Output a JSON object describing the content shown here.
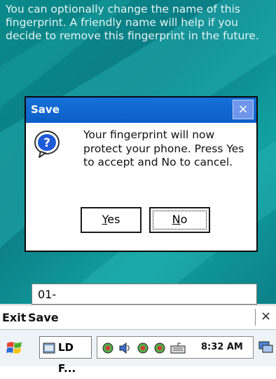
{
  "instructions": "You can optionally change the name of this fingerprint. A friendly name will help if you decide to remove this fingerprint in the future.",
  "dialog": {
    "title": "Save",
    "message": "Your fingerprint will now protect your phone. Press Yes to accept and No to cancel.",
    "yes_mnemonic": "Y",
    "yes_rest": "es",
    "no_mnemonic": "N",
    "no_rest": "o",
    "close_glyph": "×",
    "icon": "question-icon"
  },
  "name_field": {
    "value": "01-"
  },
  "menubar": {
    "exit_label": "Exit",
    "save_label": "Save",
    "close_glyph": "×"
  },
  "taskbar": {
    "task_label": "LD F...",
    "clock": "8:32 AM",
    "tray_icons": [
      "network-icon",
      "speaker-icon",
      "sync-icon",
      "sync-icon",
      "keyboard-icon"
    ]
  },
  "colors": {
    "title_bar": "#0b5fc7",
    "background": "#0a8a8a"
  }
}
